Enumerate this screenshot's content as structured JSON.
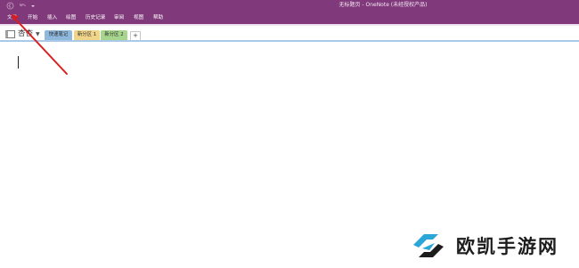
{
  "window": {
    "title": "无标题页 - OneNote (未经授权产品)"
  },
  "quick_access": {
    "items": [
      "back-icon",
      "undo-icon",
      "customize-icon"
    ]
  },
  "menu": {
    "items": [
      {
        "label": "文件"
      },
      {
        "label": "开始"
      },
      {
        "label": "插入"
      },
      {
        "label": "绘图"
      },
      {
        "label": "历史记录"
      },
      {
        "label": "审阅"
      },
      {
        "label": "视图"
      },
      {
        "label": "帮助"
      }
    ]
  },
  "notebook": {
    "name": "杏杏"
  },
  "sections": [
    {
      "label": "快速笔记",
      "color": "#8fb8dd"
    },
    {
      "label": "新分区 1",
      "color": "#f0d48a"
    },
    {
      "label": "新分区 2",
      "color": "#a7d58e"
    }
  ],
  "add_section": {
    "label": "+"
  },
  "annotation": {
    "color": "#d81e1e"
  },
  "watermark": {
    "text": "欧凯手游网",
    "accent": "#2aa6d8",
    "dark": "#1c1c1c"
  },
  "colors": {
    "brand": "#80397b"
  }
}
